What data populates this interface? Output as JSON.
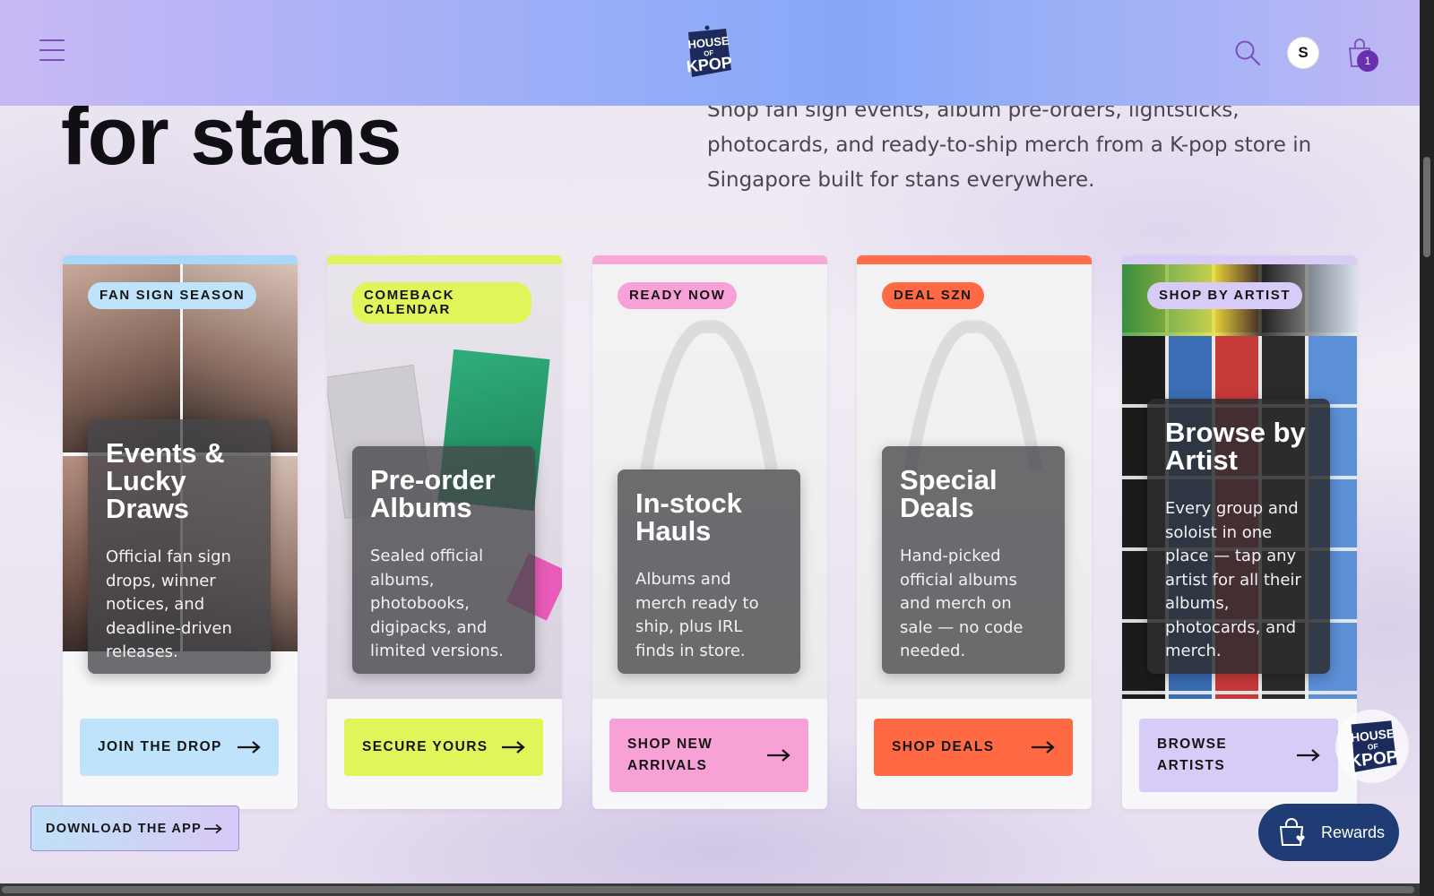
{
  "header": {
    "logo_text": "HOUSE OF KPOP",
    "user_initial": "S",
    "cart_count": "1"
  },
  "hero": {
    "title": "for stans",
    "description": "Shop fan sign events, album pre-orders, lightsticks, photocards, and ready-to-ship merch from a K-pop store in Singapore built for stans everywhere."
  },
  "cards": [
    {
      "tag": "FAN SIGN SEASON",
      "title": "Events & Lucky Draws",
      "description": "Official fan sign drops, winner notices, and deadline-driven releases.",
      "button": "JOIN THE DROP",
      "accent": "#bfe3fb",
      "top_color": "#a9d8f8"
    },
    {
      "tag": "COMEBACK CALENDAR",
      "title": "Pre-order Albums",
      "description": "Sealed official albums, photobooks, digipacks, and limited versions.",
      "button": "SECURE YOURS",
      "accent": "#e0f55a",
      "top_color": "#dff35a"
    },
    {
      "tag": "READY NOW",
      "title": "In-stock Hauls",
      "description": "Albums and merch ready to ship, plus IRL finds in store.",
      "button": "SHOP NEW ARRIVALS",
      "accent": "#f7a1d6",
      "top_color": "#f7a8d8"
    },
    {
      "tag": "DEAL SZN",
      "title": "Special Deals",
      "description": "Hand-picked official albums and merch on sale — no code needed.",
      "button": "SHOP DEALS",
      "accent": "#ff6a45",
      "top_color": "#ff6e48"
    },
    {
      "tag": "SHOP BY ARTIST",
      "title": "Browse by Artist",
      "description": "Every group and soloist in one place — tap any artist for all their albums, photocards, and merch.",
      "button": "BROWSE ARTISTS",
      "accent": "#d7cbf7",
      "top_color": "#d9cdf7"
    }
  ],
  "floating": {
    "download_app": "DOWNLOAD THE APP",
    "rewards": "Rewards"
  },
  "icons": [
    "menu-icon",
    "search-icon",
    "cart-icon",
    "arrow-right-icon",
    "rewards-bag-icon"
  ]
}
